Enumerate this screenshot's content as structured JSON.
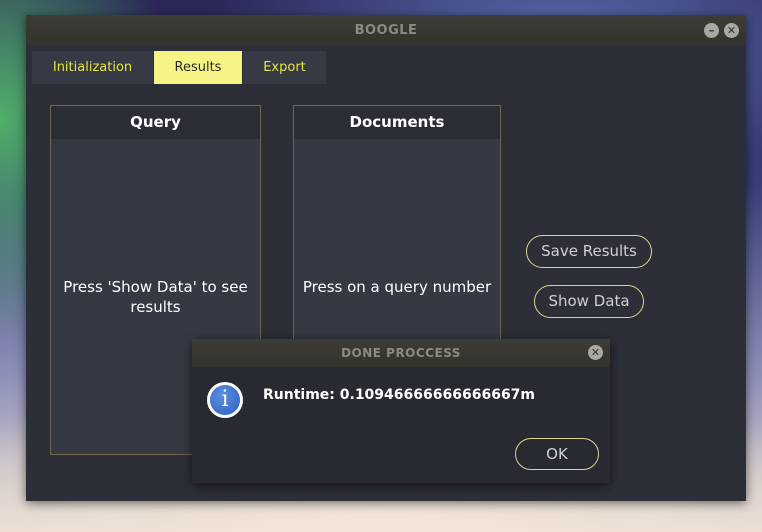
{
  "window": {
    "title": "BOOGLE",
    "minimize_symbol": "–",
    "close_symbol": "✕"
  },
  "tabs": [
    {
      "label": "Initialization",
      "active": false
    },
    {
      "label": "Results",
      "active": true
    },
    {
      "label": "Export",
      "active": false
    }
  ],
  "panels": {
    "query": {
      "header": "Query",
      "message": "Press 'Show Data' to see results"
    },
    "documents": {
      "header": "Documents",
      "message": "Press on a query number"
    }
  },
  "actions": {
    "save_label": "Save Results",
    "show_label": "Show Data"
  },
  "dialog": {
    "title": "DONE PROCCESS",
    "close_symbol": "✕",
    "icon": "info-icon",
    "icon_glyph": "i",
    "message": "Runtime: 0.10946666666666667m",
    "ok_label": "OK"
  },
  "colors": {
    "accent_tab": "#f7f486",
    "tab_text": "#e9e33f",
    "window_bg": "#2c2f37",
    "info_blue": "#2e5fbf"
  }
}
